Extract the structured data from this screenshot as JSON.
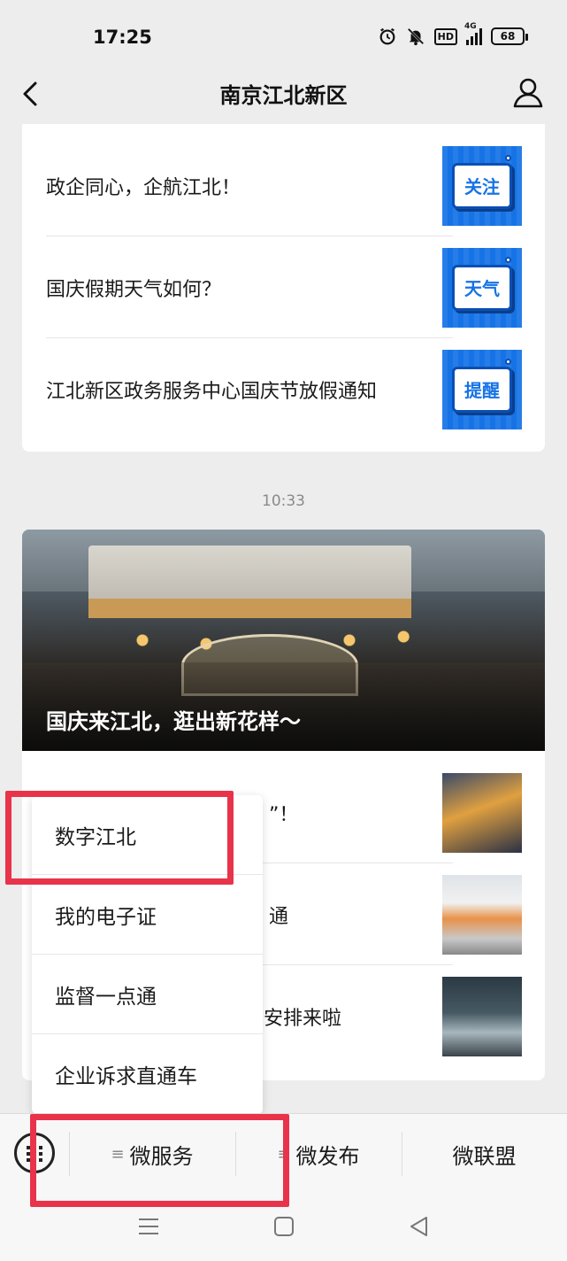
{
  "status_bar": {
    "time": "17:25",
    "network": "4G",
    "hd": "HD",
    "battery": "68"
  },
  "nav": {
    "title": "南京江北新区",
    "back_icon": "chevron-left-icon",
    "profile_icon": "person-icon"
  },
  "card1": {
    "items": [
      {
        "title": "政企同心，企航江北！",
        "badge": "关注"
      },
      {
        "title": "国庆假期天气如何？",
        "badge": "天气"
      },
      {
        "title": "江北新区政务服务中心国庆节放假通知",
        "badge": "提醒"
      }
    ]
  },
  "timestamp": "10:33",
  "card2": {
    "hero_title": "国庆来江北，逛出新花样～",
    "items": [
      {
        "title_fragment": "”！",
        "thumb": "mall-photo"
      },
      {
        "title_fragment": "通",
        "thumb": "train-photo"
      },
      {
        "title_fragment": "安排来啦",
        "thumb": "store-photo"
      }
    ]
  },
  "popup_menu": {
    "items": [
      "数字江北",
      "我的电子证",
      "监督一点通",
      "企业诉求直通车"
    ]
  },
  "menu_bar": {
    "keyboard_icon": "keyboard-toggle-icon",
    "tabs": [
      "微服务",
      "微发布",
      "微联盟"
    ]
  },
  "system_nav": [
    "menu-icon",
    "home-icon",
    "back-icon"
  ],
  "colors": {
    "highlight": "#e8334a",
    "badge_blue": "#1673e6",
    "background": "#ededed"
  }
}
